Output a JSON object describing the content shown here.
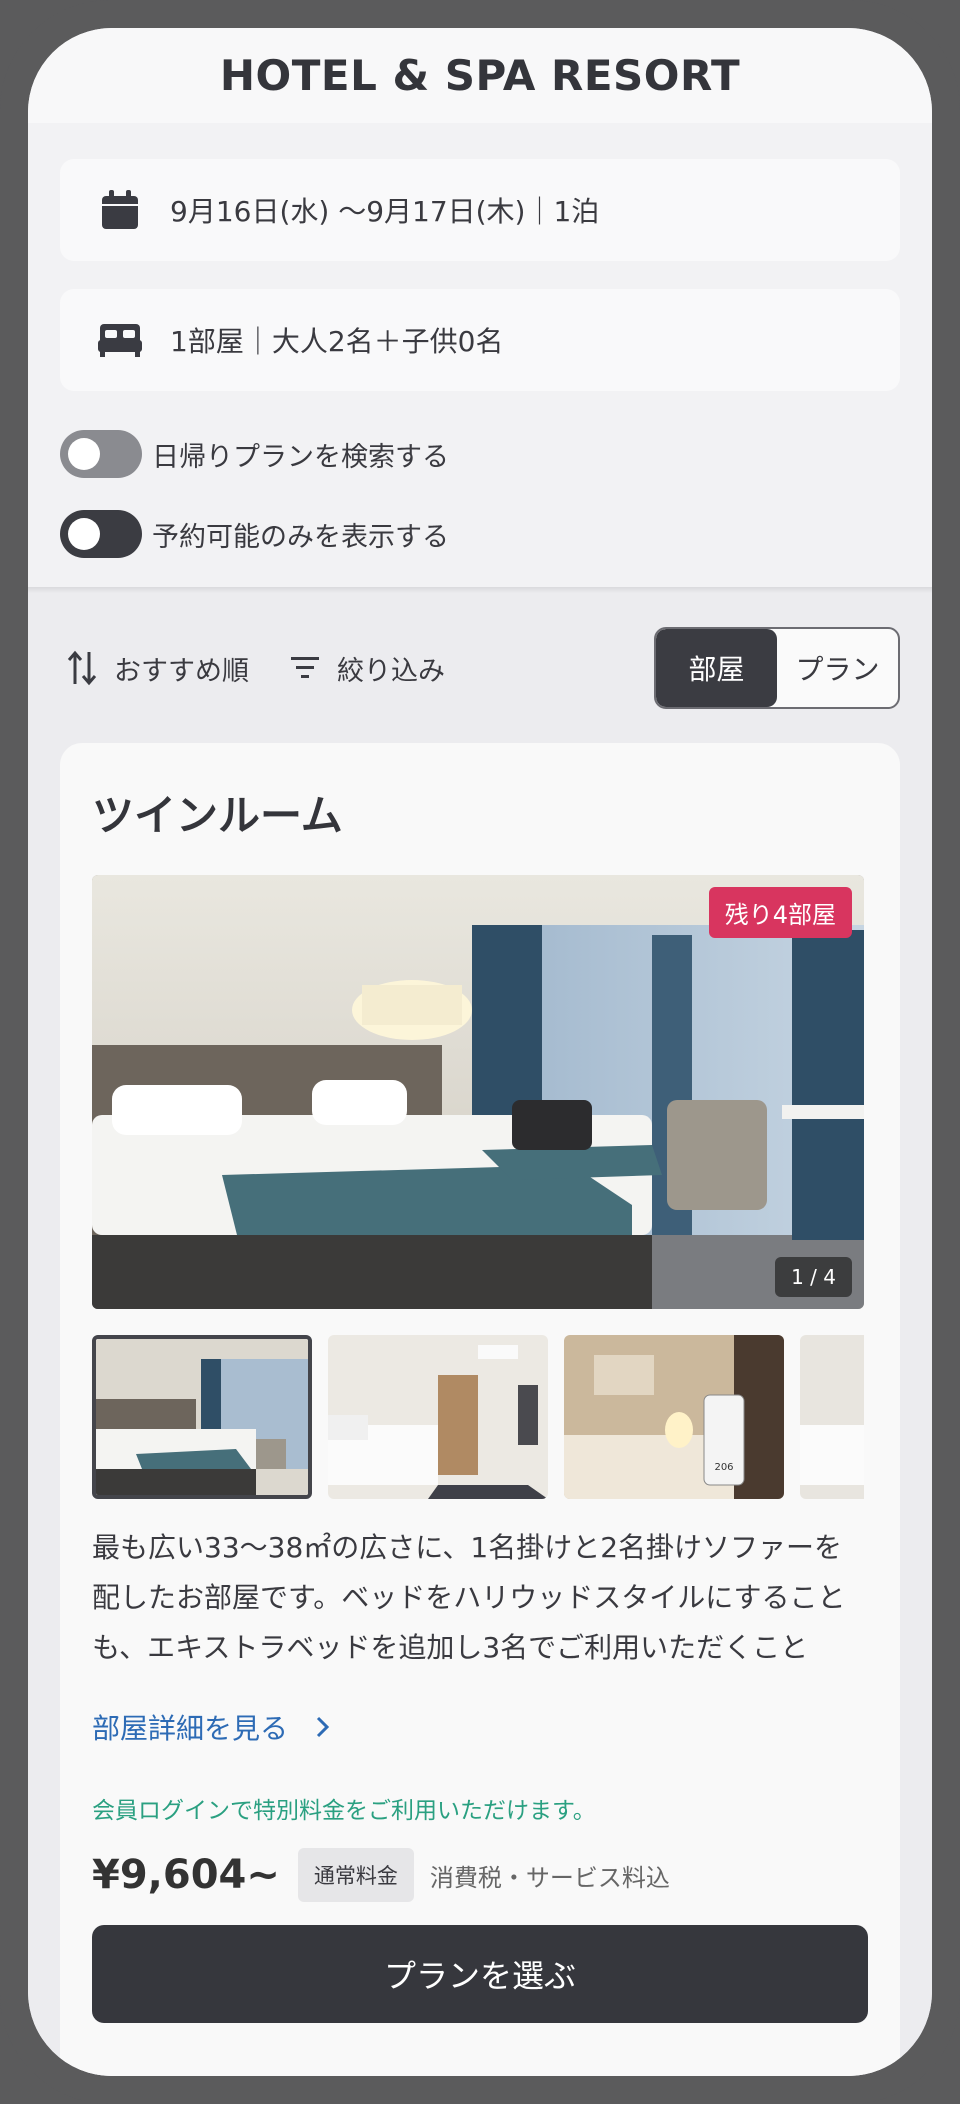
{
  "header": {
    "title": "HOTEL & SPA RESORT"
  },
  "search": {
    "dates": "9月16日(水) 〜9月17日(木)｜1泊",
    "guests": "1部屋｜大人2名＋子供0名",
    "day_trip_toggle": {
      "label": "日帰りプランを検索する",
      "on": false
    },
    "available_only_toggle": {
      "label": "予約可能のみを表示する",
      "on": true
    }
  },
  "controls": {
    "sort_label": "おすすめ順",
    "filter_label": "絞り込み",
    "segment": {
      "room": "部屋",
      "plan": "プラン",
      "selected": "部屋"
    }
  },
  "card": {
    "title": "ツインルーム",
    "rooms_left": "残り4部屋",
    "photo_counter": "1 / 4",
    "description": "最も広い33〜38㎡の広さに、1名掛けと2名掛けソファーを配したお部屋です。ベッドをハリウッドスタイルにすることも、エキストラベッドを追加し3名でご利用いただくこと",
    "detail_link": "部屋詳細を見る",
    "member_notice": "会員ログインで特別料金をご利用いただけます。",
    "price": "¥9,604~",
    "rate_tag": "通常料金",
    "tax_note": "消費税・サービス料込",
    "cta": "プランを選ぶ",
    "door_tag_number": "206"
  },
  "colors": {
    "accent_dark": "#36373d",
    "badge_red": "#d8355f",
    "link_blue": "#2d6bb5",
    "member_green": "#2aa081"
  }
}
